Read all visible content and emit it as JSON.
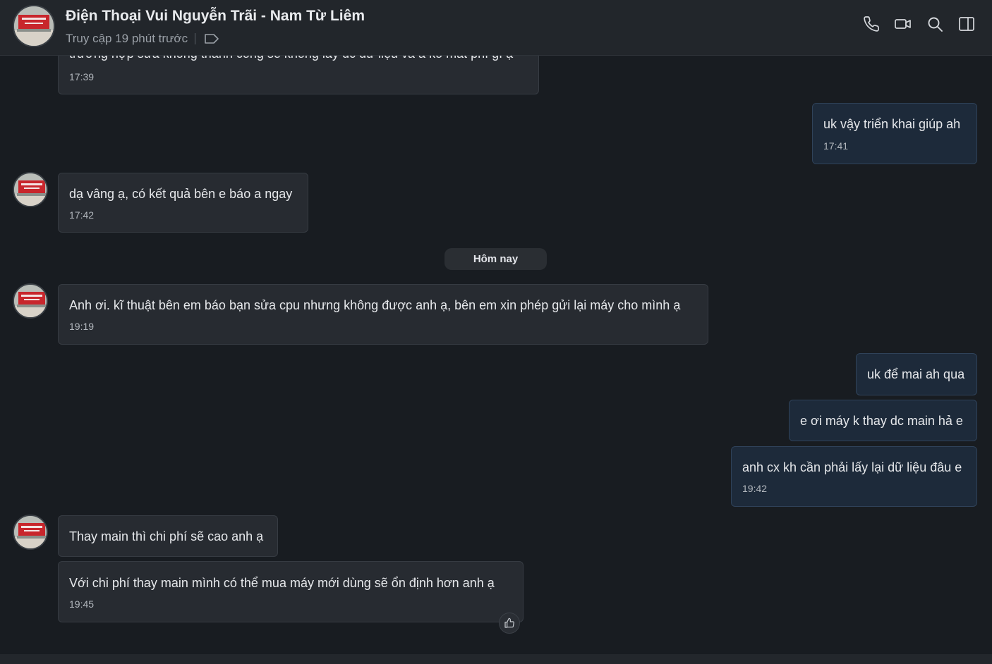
{
  "header": {
    "title": "Điện Thoại Vui Nguyễn Trãi - Nam Từ Liêm",
    "status": "Truy cập 19 phút trước"
  },
  "messages": [
    {
      "direction": "in",
      "text": "trường hợp sửa không thành công sẽ không lấy dc dữ liệu và a ko mất phí gì ạ",
      "time": "17:39"
    },
    {
      "direction": "out",
      "text": "uk vậy triển khai giúp ah",
      "time": "17:41"
    },
    {
      "direction": "in",
      "text": "dạ vâng ạ, có kết quả bên e báo a ngay",
      "time": "17:42"
    },
    {
      "direction": "in",
      "text": "Anh ơi. kĩ thuật bên em báo bạn sửa cpu nhưng không được anh ạ, bên em xin phép gửi lại máy cho mình ạ",
      "time": "19:19"
    },
    {
      "direction": "out",
      "text": "uk để mai ah qua",
      "time": ""
    },
    {
      "direction": "out",
      "text": "e ơi máy k thay dc main hả e",
      "time": ""
    },
    {
      "direction": "out",
      "text": "anh cx kh cần phải lấy lại dữ liệu đâu e",
      "time": "19:42"
    },
    {
      "direction": "in",
      "text": "Thay main thì chi phí sẽ cao anh ạ",
      "time": ""
    },
    {
      "direction": "in",
      "text": "Với chi phí thay main  mình có thể mua máy mới dùng sẽ ổn định hơn anh ạ",
      "time": "19:45"
    }
  ],
  "date_separator": "Hôm nay",
  "icons": {
    "call": "phone-icon",
    "video": "video-icon",
    "search": "search-icon",
    "panel": "sidebar-toggle-icon",
    "tag": "tag-icon",
    "reaction": "thumbs-up-icon"
  }
}
